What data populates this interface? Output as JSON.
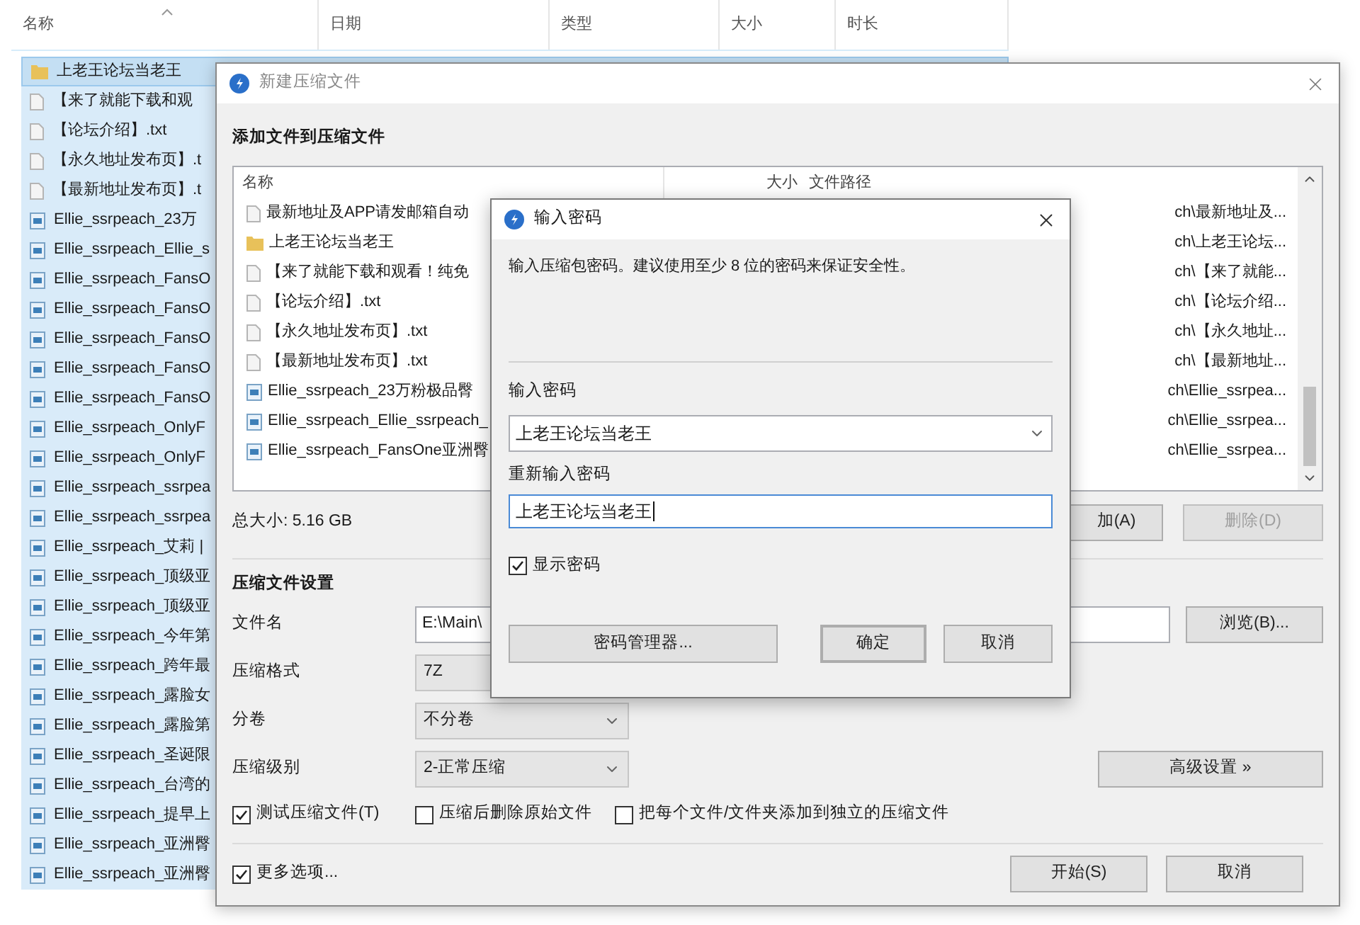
{
  "explorer": {
    "columns": [
      {
        "label": "名称",
        "sorted": true
      },
      {
        "label": "日期",
        "sorted": false
      },
      {
        "label": "类型",
        "sorted": false
      },
      {
        "label": "大小",
        "sorted": false
      },
      {
        "label": "时长",
        "sorted": false
      }
    ],
    "files": [
      {
        "name": "上老王论坛当老王",
        "kind": "folder",
        "selected": true
      },
      {
        "name": "【来了就能下载和观",
        "kind": "text",
        "selected": true
      },
      {
        "name": "【论坛介绍】.txt",
        "kind": "text",
        "selected": true
      },
      {
        "name": "【永久地址发布页】.t",
        "kind": "text",
        "selected": true
      },
      {
        "name": "【最新地址发布页】.t",
        "kind": "text",
        "selected": true
      },
      {
        "name": "Ellie_ssrpeach_23万",
        "kind": "video",
        "selected": true
      },
      {
        "name": "Ellie_ssrpeach_Ellie_s",
        "kind": "video",
        "selected": true
      },
      {
        "name": "Ellie_ssrpeach_FansO",
        "kind": "video",
        "selected": true
      },
      {
        "name": "Ellie_ssrpeach_FansO",
        "kind": "video",
        "selected": true
      },
      {
        "name": "Ellie_ssrpeach_FansO",
        "kind": "video",
        "selected": true
      },
      {
        "name": "Ellie_ssrpeach_FansO",
        "kind": "video",
        "selected": true
      },
      {
        "name": "Ellie_ssrpeach_FansO",
        "kind": "video",
        "selected": true
      },
      {
        "name": "Ellie_ssrpeach_OnlyF",
        "kind": "video",
        "selected": true
      },
      {
        "name": "Ellie_ssrpeach_OnlyF",
        "kind": "video",
        "selected": true
      },
      {
        "name": "Ellie_ssrpeach_ssrpea",
        "kind": "video",
        "selected": true
      },
      {
        "name": "Ellie_ssrpeach_ssrpea",
        "kind": "video",
        "selected": true
      },
      {
        "name": "Ellie_ssrpeach_艾莉 |",
        "kind": "video",
        "selected": true
      },
      {
        "name": "Ellie_ssrpeach_顶级亚",
        "kind": "video",
        "selected": true
      },
      {
        "name": "Ellie_ssrpeach_顶级亚",
        "kind": "video",
        "selected": true
      },
      {
        "name": "Ellie_ssrpeach_今年第",
        "kind": "video",
        "selected": true
      },
      {
        "name": "Ellie_ssrpeach_跨年最",
        "kind": "video",
        "selected": true
      },
      {
        "name": "Ellie_ssrpeach_露脸女",
        "kind": "video",
        "selected": true
      },
      {
        "name": "Ellie_ssrpeach_露脸第",
        "kind": "video",
        "selected": true
      },
      {
        "name": "Ellie_ssrpeach_圣诞限",
        "kind": "video",
        "selected": true
      },
      {
        "name": "Ellie_ssrpeach_台湾的",
        "kind": "video",
        "selected": true
      },
      {
        "name": "Ellie_ssrpeach_提早上",
        "kind": "video",
        "selected": true
      },
      {
        "name": "Ellie_ssrpeach_亚洲臀",
        "kind": "video",
        "selected": true
      },
      {
        "name": "Ellie_ssrpeach_亚洲臀",
        "kind": "video",
        "selected": true
      }
    ]
  },
  "archive_dialog": {
    "title": "新建压缩文件",
    "section_title": "添加文件到压缩文件",
    "table": {
      "columns": [
        "名称",
        "大小",
        "文件路径"
      ],
      "rows": [
        {
          "name": "最新地址及APP请发邮箱自动",
          "kind": "text",
          "path": "ch\\最新地址及..."
        },
        {
          "name": "上老王论坛当老王",
          "kind": "folder",
          "path": "ch\\上老王论坛..."
        },
        {
          "name": "【来了就能下载和观看！纯免",
          "kind": "text",
          "path": "ch\\【来了就能..."
        },
        {
          "name": "【论坛介绍】.txt",
          "kind": "text",
          "path": "ch\\【论坛介绍..."
        },
        {
          "name": "【永久地址发布页】.txt",
          "kind": "text",
          "path": "ch\\【永久地址..."
        },
        {
          "name": "【最新地址发布页】.txt",
          "kind": "text",
          "path": "ch\\【最新地址..."
        },
        {
          "name": "Ellie_ssrpeach_23万粉极品臀",
          "kind": "video",
          "path": "ch\\Ellie_ssrpea..."
        },
        {
          "name": "Ellie_ssrpeach_Ellie_ssrpeach_",
          "kind": "video",
          "path": "ch\\Ellie_ssrpea..."
        },
        {
          "name": "Ellie_ssrpeach_FansOne亚洲臀",
          "kind": "video",
          "path": "ch\\Ellie_ssrpea..."
        }
      ]
    },
    "total_size": "总大小: 5.16 GB",
    "add_button": {
      "label": "加(A)",
      "disabled": false
    },
    "remove_button": {
      "label": "删除(D)",
      "disabled": true
    },
    "settings_title": "压缩文件设置",
    "fields": [
      {
        "label": "文件名",
        "kind": "text",
        "value": "E:\\Main\\",
        "button": "浏览(B)..."
      },
      {
        "label": "压缩格式",
        "kind": "select",
        "value": "7Z"
      },
      {
        "label": "分卷",
        "kind": "select",
        "value": "不分卷"
      },
      {
        "label": "压缩级别",
        "kind": "select",
        "value": "2-正常压缩",
        "button": "高级设置 »"
      }
    ],
    "options": [
      {
        "label": "测试压缩文件(T)",
        "checked": true
      },
      {
        "label": "压缩后删除原始文件",
        "checked": false
      },
      {
        "label": "把每个文件/文件夹添加到独立的压缩文件",
        "checked": false
      }
    ],
    "more_options": {
      "label": "更多选项...",
      "checked": true
    },
    "start_button": "开始(S)",
    "cancel_button": "取消"
  },
  "password_dialog": {
    "title": "输入密码",
    "description": "输入压缩包密码。建议使用至少 8 位的密码来保证安全性。",
    "password_label": "输入密码",
    "password_value": "上老王论坛当老王",
    "confirm_label": "重新输入密码",
    "confirm_value": "上老王论坛当老王",
    "show_password": {
      "label": "显示密码",
      "checked": true
    },
    "manager_button": "密码管理器...",
    "ok_button": "确定",
    "cancel_button": "取消"
  }
}
